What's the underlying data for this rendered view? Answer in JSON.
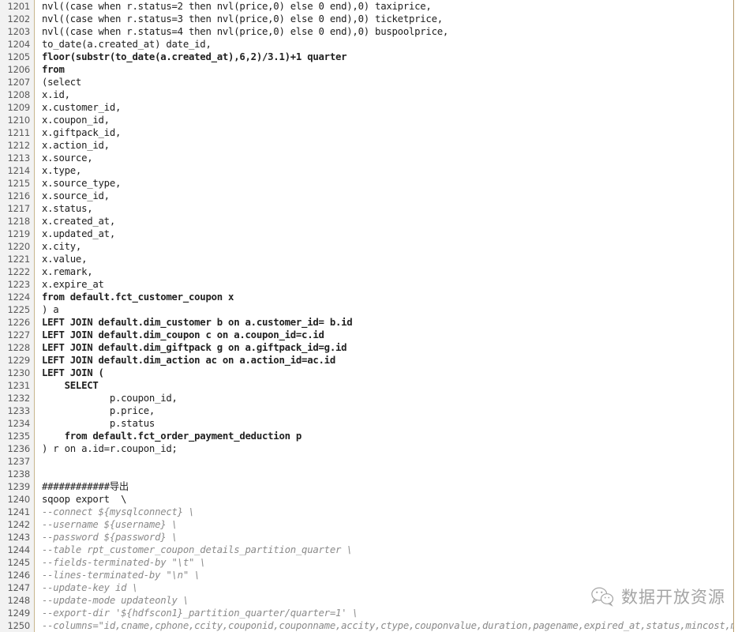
{
  "editor": {
    "first_line_number": 1201,
    "last_line_number": 1250,
    "gutter_color": "#f2f2f2",
    "gutter_text_color": "#5a5a5a",
    "gutter_rule_color": "#c8b68e",
    "margin_rule_color": "#b59b6a",
    "code_color": "#202020",
    "comment_color": "#8a8a8a",
    "background": "#ffffff",
    "language": "sql"
  },
  "watermark": {
    "icon": "wechat-icon",
    "text": "数据开放资源"
  },
  "lines": [
    {
      "n": "1201",
      "text": "nvl((case when r.status=2 then nvl(price,0) else 0 end),0) taxiprice,",
      "style": "code"
    },
    {
      "n": "1202",
      "text": "nvl((case when r.status=3 then nvl(price,0) else 0 end),0) ticketprice,",
      "style": "code"
    },
    {
      "n": "1203",
      "text": "nvl((case when r.status=4 then nvl(price,0) else 0 end),0) buspoolprice,",
      "style": "code"
    },
    {
      "n": "1204",
      "text": "to_date(a.created_at) date_id,",
      "style": "code"
    },
    {
      "n": "1205",
      "text": "floor(substr(to_date(a.created_at),6,2)/3.1)+1 quarter",
      "style": "kw"
    },
    {
      "n": "1206",
      "text": "from",
      "style": "kw"
    },
    {
      "n": "1207",
      "text": "(select",
      "style": "code"
    },
    {
      "n": "1208",
      "text": "x.id,",
      "style": "code"
    },
    {
      "n": "1209",
      "text": "x.customer_id,",
      "style": "code"
    },
    {
      "n": "1210",
      "text": "x.coupon_id,",
      "style": "code"
    },
    {
      "n": "1211",
      "text": "x.giftpack_id,",
      "style": "code"
    },
    {
      "n": "1212",
      "text": "x.action_id,",
      "style": "code"
    },
    {
      "n": "1213",
      "text": "x.source,",
      "style": "code"
    },
    {
      "n": "1214",
      "text": "x.type,",
      "style": "code"
    },
    {
      "n": "1215",
      "text": "x.source_type,",
      "style": "code"
    },
    {
      "n": "1216",
      "text": "x.source_id,",
      "style": "code"
    },
    {
      "n": "1217",
      "text": "x.status,",
      "style": "code"
    },
    {
      "n": "1218",
      "text": "x.created_at,",
      "style": "code"
    },
    {
      "n": "1219",
      "text": "x.updated_at,",
      "style": "code"
    },
    {
      "n": "1220",
      "text": "x.city,",
      "style": "code"
    },
    {
      "n": "1221",
      "text": "x.value,",
      "style": "code"
    },
    {
      "n": "1222",
      "text": "x.remark,",
      "style": "code"
    },
    {
      "n": "1223",
      "text": "x.expire_at",
      "style": "code"
    },
    {
      "n": "1224",
      "text": "from default.fct_customer_coupon x",
      "style": "kw"
    },
    {
      "n": "1225",
      "text": ") a",
      "style": "code"
    },
    {
      "n": "1226",
      "text": "LEFT JOIN default.dim_customer b on a.customer_id= b.id",
      "style": "kw"
    },
    {
      "n": "1227",
      "text": "LEFT JOIN default.dim_coupon c on a.coupon_id=c.id",
      "style": "kw"
    },
    {
      "n": "1228",
      "text": "LEFT JOIN default.dim_giftpack g on a.giftpack_id=g.id",
      "style": "kw"
    },
    {
      "n": "1229",
      "text": "LEFT JOIN default.dim_action ac on a.action_id=ac.id",
      "style": "kw"
    },
    {
      "n": "1230",
      "text": "LEFT JOIN (",
      "style": "kw"
    },
    {
      "n": "1231",
      "text": "    SELECT",
      "style": "kw"
    },
    {
      "n": "1232",
      "text": "            p.coupon_id,",
      "style": "code"
    },
    {
      "n": "1233",
      "text": "            p.price,",
      "style": "code"
    },
    {
      "n": "1234",
      "text": "            p.status",
      "style": "code"
    },
    {
      "n": "1235",
      "text": "    from default.fct_order_payment_deduction p",
      "style": "kw"
    },
    {
      "n": "1236",
      "text": ") r on a.id=r.coupon_id;",
      "style": "code"
    },
    {
      "n": "1237",
      "text": "",
      "style": "code"
    },
    {
      "n": "1238",
      "text": "",
      "style": "code"
    },
    {
      "n": "1239",
      "text": "############导出",
      "style": "code"
    },
    {
      "n": "1240",
      "text": "sqoop export  \\",
      "style": "code"
    },
    {
      "n": "1241",
      "text": "--connect ${mysqlconnect} \\",
      "style": "comment"
    },
    {
      "n": "1242",
      "text": "--username ${username} \\",
      "style": "comment"
    },
    {
      "n": "1243",
      "text": "--password ${password} \\",
      "style": "comment"
    },
    {
      "n": "1244",
      "text": "--table rpt_customer_coupon_details_partition_quarter \\",
      "style": "comment"
    },
    {
      "n": "1245",
      "text": "--fields-terminated-by \"\\t\" \\",
      "style": "comment"
    },
    {
      "n": "1246",
      "text": "--lines-terminated-by \"\\n\" \\",
      "style": "comment"
    },
    {
      "n": "1247",
      "text": "--update-key id \\",
      "style": "comment"
    },
    {
      "n": "1248",
      "text": "--update-mode updateonly \\",
      "style": "comment"
    },
    {
      "n": "1249",
      "text": "--export-dir '${hdfscon1}_partition_quarter/quarter=1' \\",
      "style": "comment"
    },
    {
      "n": "1250",
      "text": "--columns=\"id,cname,cphone,ccity,couponid,couponname,accity,ctype,couponvalue,duration,pagename,expired_at,status,mincost,maxdi",
      "style": "comment"
    }
  ]
}
